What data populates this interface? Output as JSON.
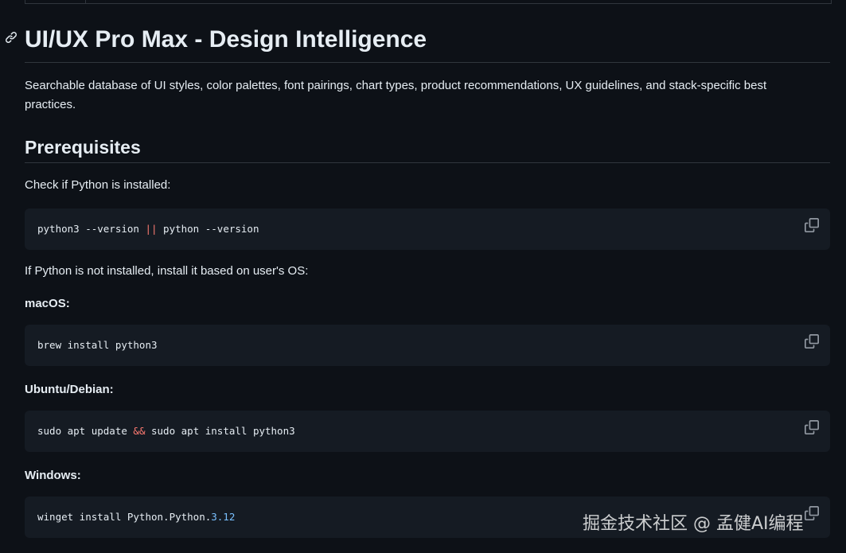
{
  "heading": {
    "title": "UI/UX Pro Max - Design Intelligence",
    "anchor_icon": "link-icon"
  },
  "description": "Searchable database of UI styles, color palettes, font pairings, chart types, product recommendations, UX guidelines, and stack-specific best practices.",
  "prerequisites": {
    "title": "Prerequisites",
    "check_text": "Check if Python is installed:",
    "check_code": {
      "part1": "python3 --version ",
      "op": "||",
      "part2": " python --version"
    },
    "install_text": "If Python is not installed, install it based on user's OS:",
    "macos": {
      "label": "macOS:",
      "code": "brew install python3"
    },
    "ubuntu": {
      "label": "Ubuntu/Debian:",
      "code_part1": "sudo apt update ",
      "op": "&&",
      "code_part2": " sudo apt install python3"
    },
    "windows": {
      "label": "Windows:",
      "code_part1": "winget install Python.Python.",
      "version": "3.12"
    }
  },
  "copy_icon": "copy-icon",
  "watermark": "掘金技术社区 @ 孟健AI编程",
  "colors": {
    "background": "#0d1117",
    "code_background": "#151b23",
    "text": "#e6edf3",
    "border": "#30363d",
    "operator": "#ff7b72",
    "number": "#79c0ff"
  }
}
